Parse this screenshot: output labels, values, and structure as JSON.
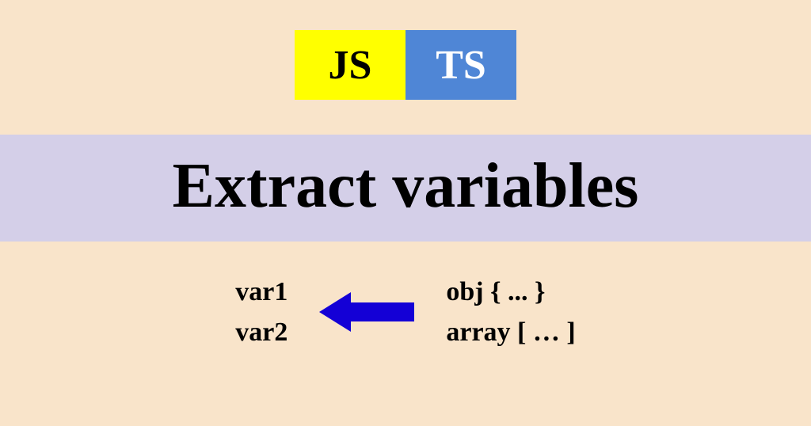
{
  "badges": {
    "js": "JS",
    "ts": "TS"
  },
  "title": "Extract variables",
  "left": {
    "line1": "var1",
    "line2": "var2"
  },
  "right": {
    "line1": "obj { ... }",
    "line2": "array [ … ]"
  },
  "colors": {
    "background": "#f9e4ca",
    "jsBg": "#ffff00",
    "tsBg": "#4f86d6",
    "bandBg": "#d4cfe8",
    "arrow": "#1400d6"
  }
}
